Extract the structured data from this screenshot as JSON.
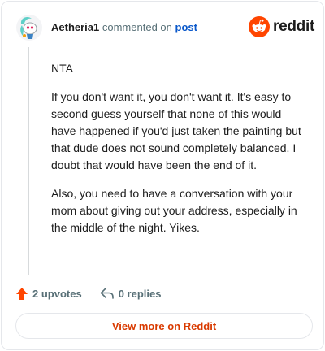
{
  "header": {
    "username": "Aetheria1",
    "commented_text": "commented on",
    "post_link": "post",
    "brand": "reddit"
  },
  "comment": {
    "paragraphs": [
      "NTA",
      "If you don't want it, you don't want it. It's easy to second guess yourself that none of this would have happened if you'd just taken the painting but that dude does not sound completely balanced. I doubt that would have been the end of it.",
      "Also, you need to have a conversation with your mom about giving out your address, especially in the middle of the night. Yikes."
    ]
  },
  "actions": {
    "upvotes": "2 upvotes",
    "replies": "0 replies"
  },
  "footer": {
    "view_more": "View more on Reddit"
  },
  "colors": {
    "brand_orange": "#ff4500",
    "link_blue": "#0a58ca",
    "view_more_text": "#d93a00",
    "avatar_teal": "#5fd0c8"
  },
  "icons": {
    "avatar": "snoo-avatar-icon",
    "logo": "reddit-snoo-icon",
    "upvote": "upvote-arrow-icon",
    "reply": "reply-arrow-icon"
  }
}
